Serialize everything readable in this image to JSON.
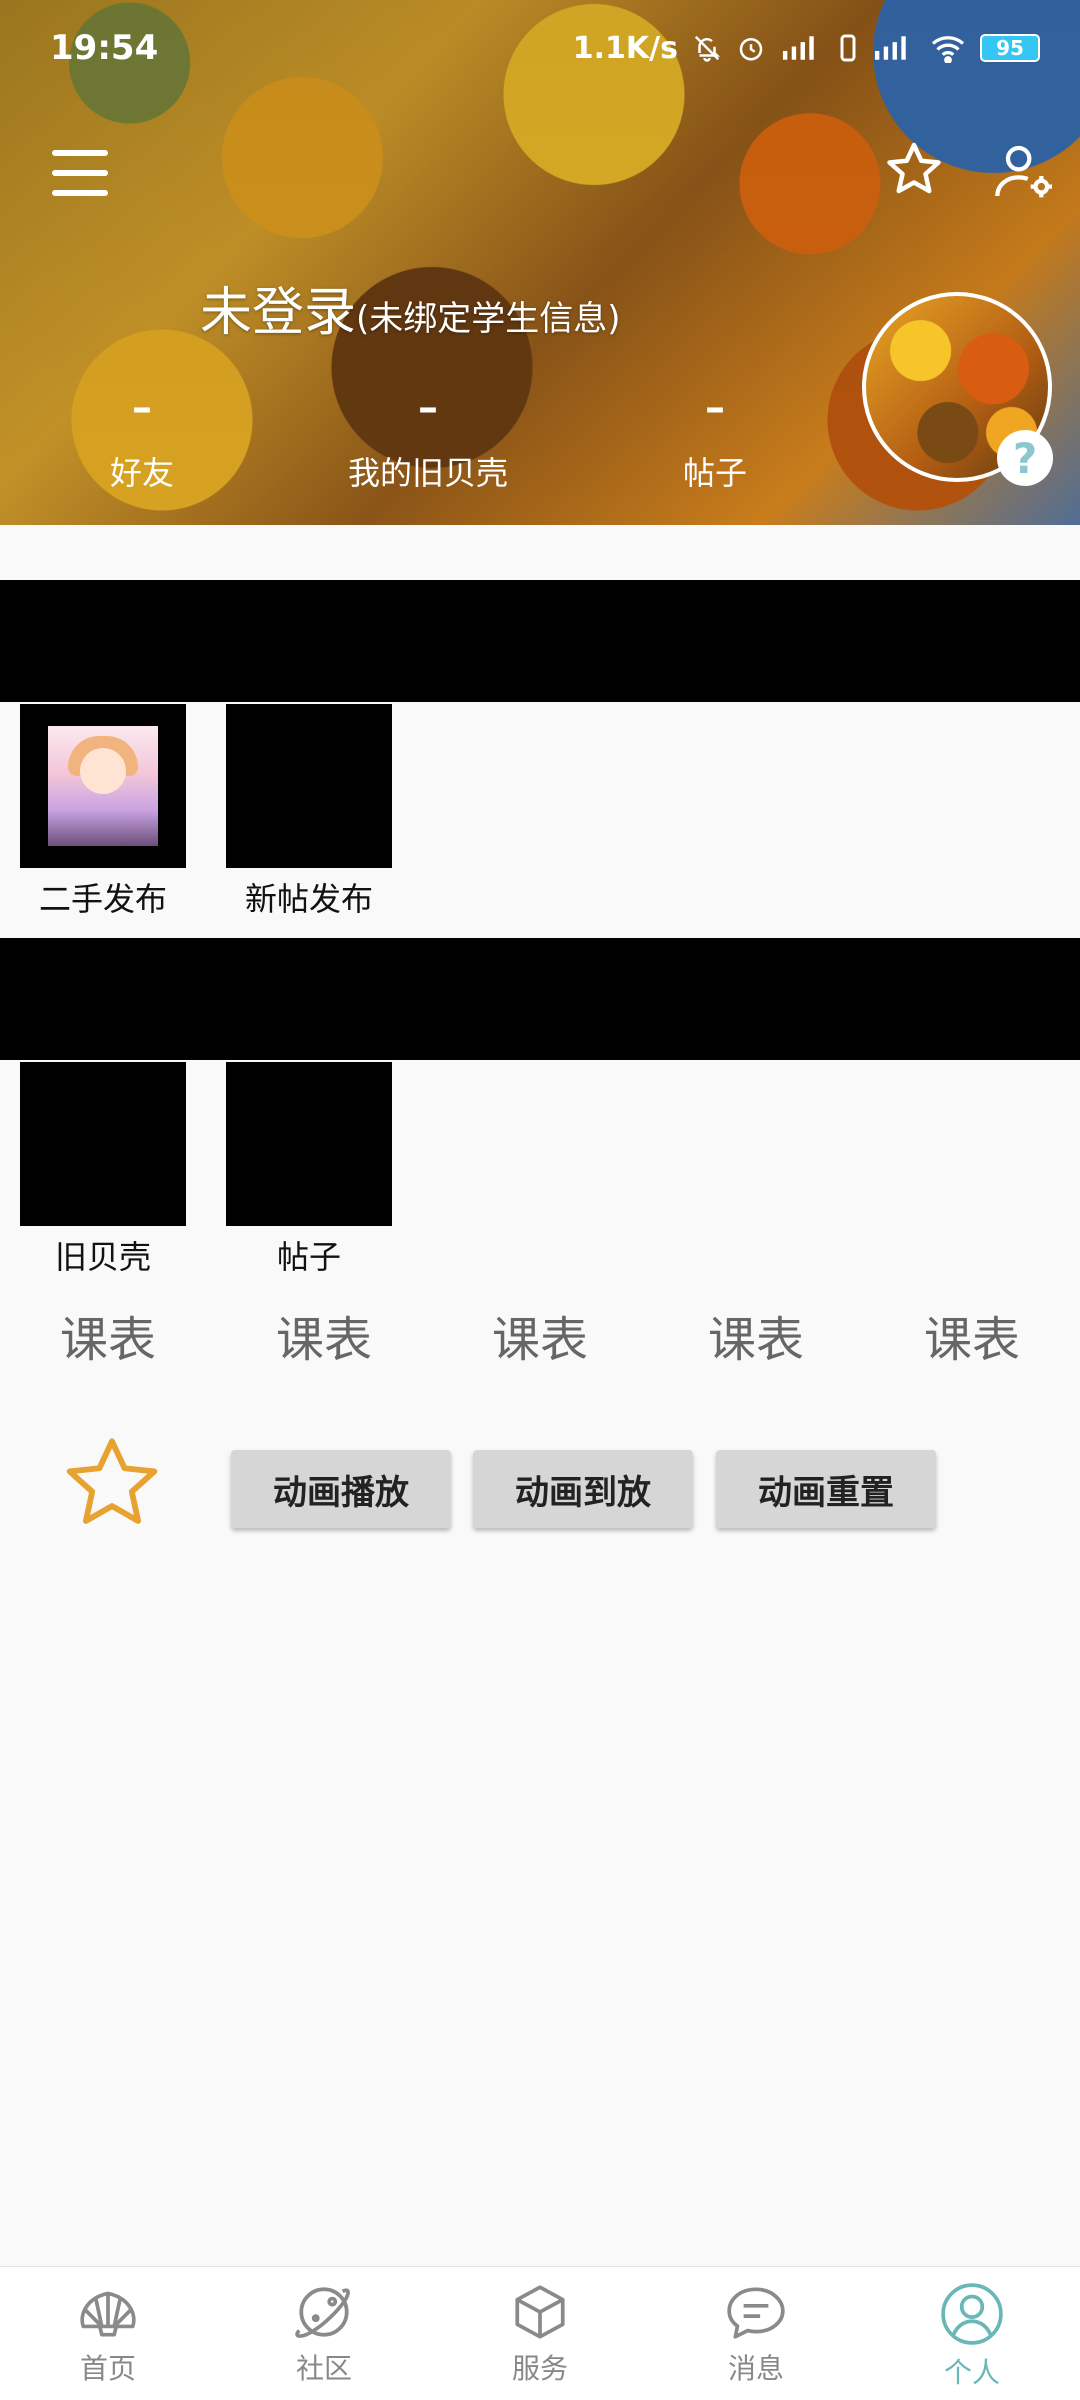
{
  "status_bar": {
    "time": "19:54",
    "network_speed": "1.1K/s",
    "battery": "95"
  },
  "header": {
    "title": "未登录",
    "subtitle": "(未绑定学生信息)",
    "stats": [
      {
        "value": "–",
        "label": "好友"
      },
      {
        "value": "–",
        "label": "我的旧贝壳"
      },
      {
        "value": "–",
        "label": "帖子"
      }
    ],
    "help_badge": "?"
  },
  "publish_section": {
    "tiles": [
      {
        "label": "二手发布"
      },
      {
        "label": "新帖发布"
      }
    ]
  },
  "mine_section": {
    "tiles": [
      {
        "label": "旧贝壳"
      },
      {
        "label": "帖子"
      }
    ]
  },
  "schedule_row": [
    "课表",
    "课表",
    "课表",
    "课表",
    "课表"
  ],
  "animation_controls": {
    "play": "动画播放",
    "reverse": "动画到放",
    "reset": "动画重置"
  },
  "bottom_nav": [
    {
      "label": "首页",
      "icon": "shell-icon"
    },
    {
      "label": "社区",
      "icon": "planet-icon"
    },
    {
      "label": "服务",
      "icon": "cube-icon"
    },
    {
      "label": "消息",
      "icon": "chat-icon"
    },
    {
      "label": "个人",
      "icon": "person-icon",
      "active": true
    }
  ],
  "colors": {
    "accent": "#69b7b6",
    "star": "#e8a230",
    "battery": "#34c7f5"
  }
}
